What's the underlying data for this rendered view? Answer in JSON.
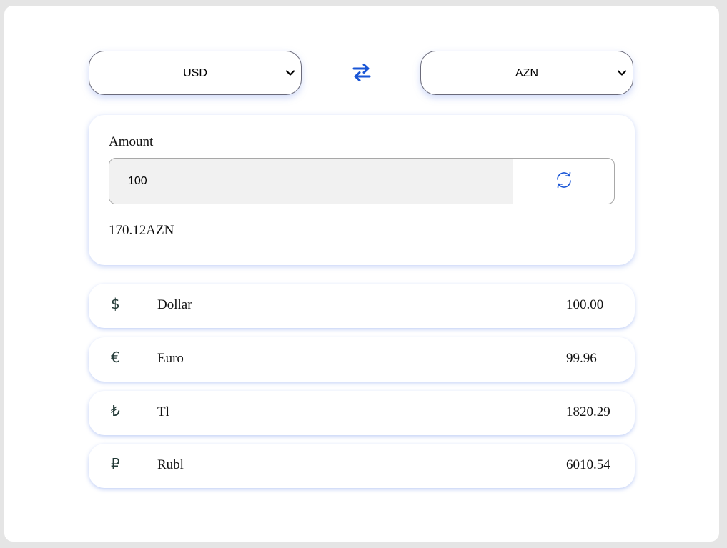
{
  "from_select": {
    "value": "USD",
    "icon": "chevron-down-icon"
  },
  "to_select": {
    "value": "AZN",
    "icon": "chevron-down-icon"
  },
  "swap": {
    "icon": "swap-arrows-icon",
    "color": "#1a56d6"
  },
  "converter": {
    "label": "Amount",
    "input_value": "100",
    "refresh_icon": "refresh-icon",
    "refresh_color": "#1a56d6",
    "result": "170.12AZN"
  },
  "currencies": [
    {
      "symbol": "$",
      "icon": "dollar-icon",
      "name": "Dollar",
      "value": "100.00"
    },
    {
      "symbol": "€",
      "icon": "euro-icon",
      "name": "Euro",
      "value": "99.96"
    },
    {
      "symbol": "₺",
      "icon": "lira-icon",
      "name": "Tl",
      "value": "1820.29"
    },
    {
      "symbol": "₽",
      "icon": "ruble-icon",
      "name": "Rubl",
      "value": "6010.54"
    }
  ]
}
